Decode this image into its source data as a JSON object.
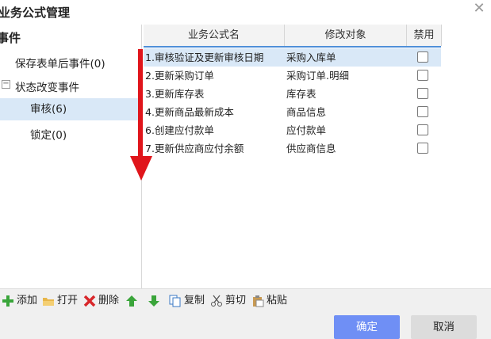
{
  "window": {
    "title": "业务公式管理",
    "close_label": "✕"
  },
  "tree": {
    "root": "事件",
    "items": [
      {
        "label": "保存表单后事件(0)"
      },
      {
        "label": "状态改变事件"
      },
      {
        "label": "审核(6)"
      },
      {
        "label": "锁定(0)"
      }
    ]
  },
  "table": {
    "columns": [
      "业务公式名",
      "修改对象",
      "禁用"
    ],
    "rows": [
      {
        "name": "1.审核验证及更新审核日期",
        "target": "采购入库单",
        "disabled": false
      },
      {
        "name": "2.更新采购订单",
        "target": "采购订单.明细",
        "disabled": false
      },
      {
        "name": "3.更新库存表",
        "target": "库存表",
        "disabled": false
      },
      {
        "name": "4.更新商品最新成本",
        "target": "商品信息",
        "disabled": false
      },
      {
        "name": "6.创建应付款单",
        "target": "应付款单",
        "disabled": false
      },
      {
        "name": "7.更新供应商应付余额",
        "target": "供应商信息",
        "disabled": false
      }
    ]
  },
  "toolbar": {
    "add": "添加",
    "open": "打开",
    "delete": "删除",
    "copy": "复制",
    "cut": "剪切",
    "paste": "粘贴"
  },
  "buttons": {
    "ok": "确定",
    "cancel": "取消"
  },
  "colors": {
    "accent": "#6f8ff5",
    "selection": "#d9e8f7",
    "annotation_arrow": "#e0151b"
  }
}
